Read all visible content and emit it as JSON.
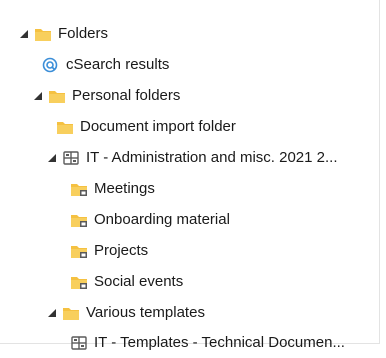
{
  "tree": {
    "items": [
      {
        "label": "Folders",
        "icon": "folder-icon",
        "expanded": true
      },
      {
        "label": "cSearch results",
        "icon": "csearch-icon"
      },
      {
        "label": "Personal folders",
        "icon": "folder-icon",
        "expanded": true
      },
      {
        "label": "Document import folder",
        "icon": "folder-icon"
      },
      {
        "label": "IT - Administration and misc. 2021 2...",
        "icon": "workspace-icon",
        "expanded": true
      },
      {
        "label": "Meetings",
        "icon": "shared-folder-icon"
      },
      {
        "label": "Onboarding material",
        "icon": "shared-folder-icon"
      },
      {
        "label": "Projects",
        "icon": "shared-folder-icon"
      },
      {
        "label": "Social events",
        "icon": "shared-folder-icon"
      },
      {
        "label": "Various templates",
        "icon": "folder-icon",
        "expanded": true
      },
      {
        "label": "IT - Templates - Technical Documen...",
        "icon": "workspace-icon"
      }
    ]
  },
  "colors": {
    "folder": "#f5c141",
    "folder_dark": "#e0a92a",
    "search": "#3b8ed8",
    "workspace": "#5a5a5a",
    "expander": "#333333"
  }
}
